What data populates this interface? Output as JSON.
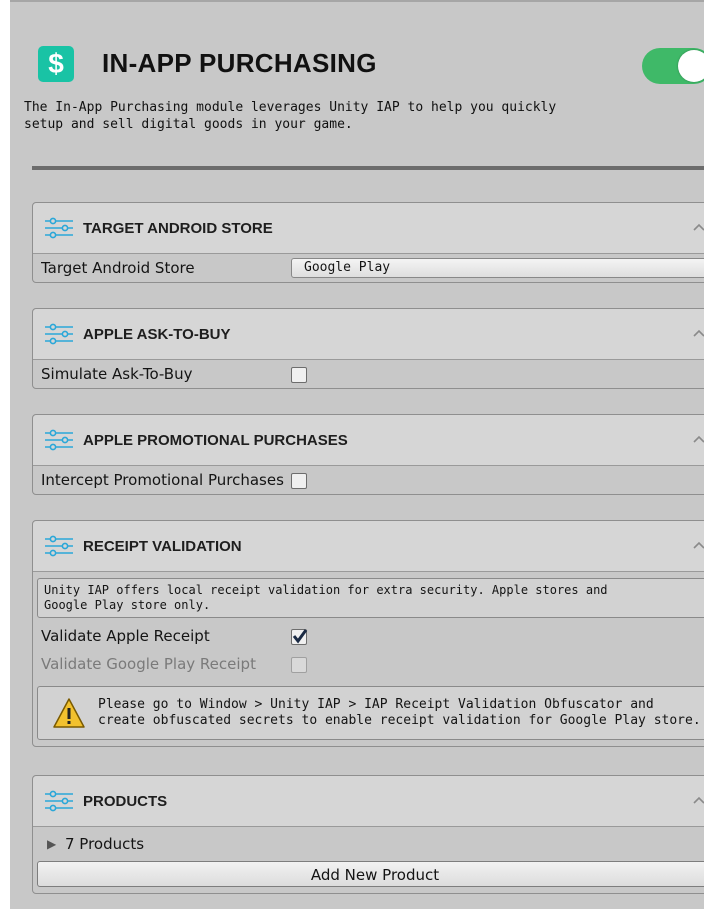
{
  "header": {
    "icon": "dollar-icon",
    "icon_glyph": "$",
    "icon_color": "#19c3a5",
    "title": "IN-APP PURCHASING",
    "toggle_on": true,
    "toggle_color": "#3fb968",
    "description_line1": "The In-App Purchasing module leverages Unity IAP to help you quickly",
    "description_line2": "setup and sell digital goods in your game."
  },
  "sections": {
    "target_store": {
      "title": "TARGET ANDROID STORE",
      "field_label": "Target Android Store",
      "dropdown_value": "Google Play",
      "dropdown_arrows": "⇕"
    },
    "ask_to_buy": {
      "title": "APPLE ASK-TO-BUY",
      "field_label": "Simulate Ask-To-Buy",
      "checked": false
    },
    "promotional": {
      "title": "APPLE PROMOTIONAL PURCHASES",
      "field_label": "Intercept Promotional Purchases",
      "checked": false
    },
    "receipt": {
      "title": "RECEIPT VALIDATION",
      "help_line1": "Unity IAP offers local receipt validation for extra security. Apple stores and",
      "help_line2": "Google Play store only.",
      "apple_label": "Validate Apple Receipt",
      "apple_checked": true,
      "google_label": "Validate Google Play Receipt",
      "google_checked": false,
      "google_disabled": true,
      "warning_line1": "Please go to Window > Unity IAP > IAP Receipt Validation Obfuscator and",
      "warning_line2": "create obfuscated secrets to enable receipt validation for Google Play store."
    },
    "products": {
      "title": "PRODUCTS",
      "foldout_glyph": "▶",
      "count_label": "7 Products",
      "add_button": "Add New Product"
    }
  }
}
